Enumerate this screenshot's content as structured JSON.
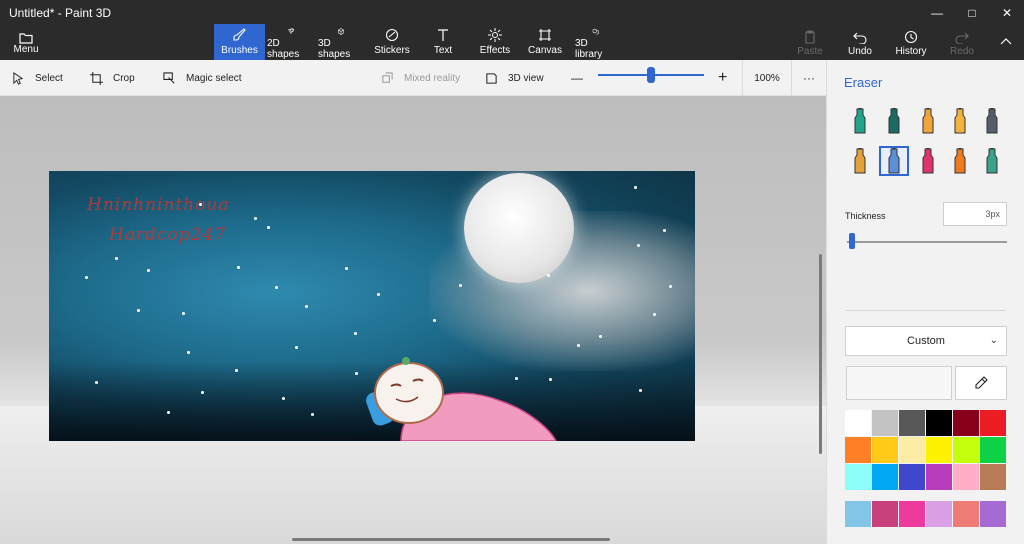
{
  "window": {
    "title": "Untitled* - Paint 3D",
    "minimize": "—",
    "maximize": "□",
    "close": "✕"
  },
  "ribbon": {
    "menu_label": "Menu",
    "tabs": [
      {
        "label": "Brushes",
        "icon": "brush-icon",
        "active": true
      },
      {
        "label": "2D shapes",
        "icon": "2d-shapes-icon"
      },
      {
        "label": "3D shapes",
        "icon": "3d-shapes-icon"
      },
      {
        "label": "Stickers",
        "icon": "stickers-icon"
      },
      {
        "label": "Text",
        "icon": "text-icon"
      },
      {
        "label": "Effects",
        "icon": "effects-icon"
      },
      {
        "label": "Canvas",
        "icon": "canvas-icon"
      },
      {
        "label": "3D library",
        "icon": "3d-library-icon"
      }
    ],
    "actions": [
      {
        "label": "Paste",
        "icon": "paste-icon",
        "enabled": false
      },
      {
        "label": "Undo",
        "icon": "undo-icon",
        "enabled": true
      },
      {
        "label": "History",
        "icon": "history-icon",
        "enabled": true
      },
      {
        "label": "Redo",
        "icon": "redo-icon",
        "enabled": false
      }
    ],
    "collapse_icon": "chevron-up-icon"
  },
  "toolbar": {
    "select_label": "Select",
    "crop_label": "Crop",
    "magic_select_label": "Magic select",
    "mixed_reality_label": "Mixed reality",
    "view3d_label": "3D view",
    "zoom_out": "—",
    "zoom_in": "+",
    "zoom_percent": "100%",
    "more": "···"
  },
  "canvas": {
    "handwriting_line1": "Hninhninthoua",
    "handwriting_line2": "Hardcop247"
  },
  "panel": {
    "title": "Eraser",
    "brushes": [
      {
        "name": "marker",
        "color": "#21a489"
      },
      {
        "name": "calligraphy-pen",
        "color": "#1b6b63"
      },
      {
        "name": "oil-brush",
        "color": "#f0a43a"
      },
      {
        "name": "watercolor",
        "color": "#f4b23f"
      },
      {
        "name": "pixel-pen",
        "color": "#555d6a"
      },
      {
        "name": "pencil",
        "color": "#e2a13b"
      },
      {
        "name": "eraser",
        "color": "#5b8fd8",
        "active": true
      },
      {
        "name": "crayon",
        "color": "#e0336b"
      },
      {
        "name": "spray-can",
        "color": "#f07a1e"
      },
      {
        "name": "fill",
        "color": "#3aa28a"
      }
    ],
    "thickness_label": "Thickness",
    "thickness_value": "3px",
    "thickness_level": 0.02,
    "color_mode": "Custom",
    "palette": [
      "#ffffff",
      "#c3c3c3",
      "#585858",
      "#000000",
      "#88001b",
      "#ec1c24",
      "#ff7f27",
      "#ffca18",
      "#fdeca6",
      "#fff200",
      "#c4ff0e",
      "#0ed145",
      "#8cfffb",
      "#00a8f3",
      "#3f48cc",
      "#b83dba",
      "#ffaec8",
      "#b97a56"
    ],
    "custom_palette": [
      "#83c5e6",
      "#c8417d",
      "#ec3b9d",
      "#d9a0e6",
      "#ef7c76",
      "#a66bd3"
    ]
  }
}
